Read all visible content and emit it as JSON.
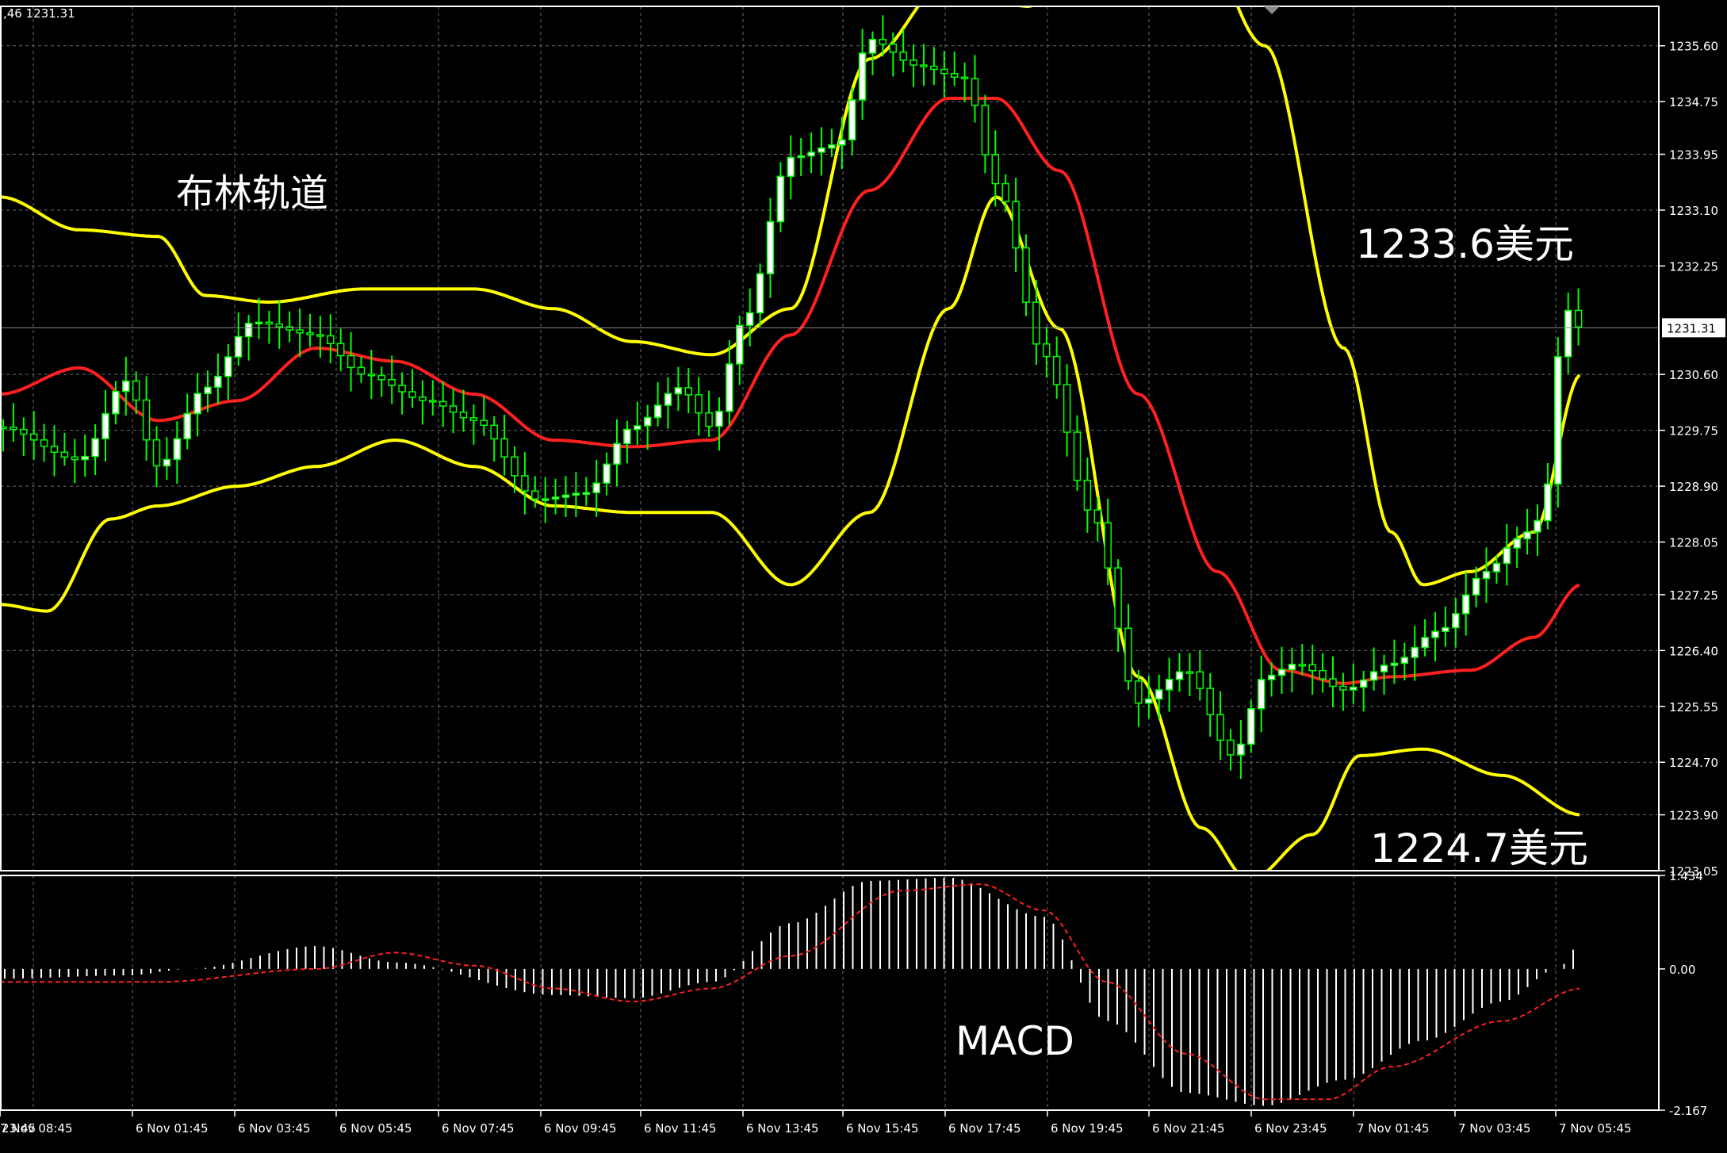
{
  "header": {
    "readout": ",46 1231.31"
  },
  "chart_data": [
    {
      "type": "candlestick",
      "title": "布林轨道",
      "annotation_upper": "1233.6美元",
      "annotation_lower": "1224.7美元",
      "current_price_label": "1231.31",
      "current_price": 1231.31,
      "ylim": [
        1223.05,
        1236.2
      ],
      "y_ticks": [
        1235.6,
        1234.75,
        1233.95,
        1233.1,
        1232.25,
        1230.6,
        1229.75,
        1228.9,
        1228.05,
        1227.25,
        1226.4,
        1225.55,
        1224.7,
        1223.9,
        1223.05
      ],
      "y_tick_labels": [
        "1235.60",
        "1234.75",
        "1233.95",
        "1233.10",
        "1232.25",
        "1230.60",
        "1229.75",
        "1228.90",
        "1228.05",
        "1227.25",
        "1226.40",
        "1225.55",
        "1224.70",
        "1223.90",
        "1223.05"
      ],
      "x_tick_labels": [
        "23:45",
        "6 Nov 01:45",
        "6 Nov 03:45",
        "6 Nov 05:45",
        "6 Nov 07:45",
        "6 Nov 09:45",
        "6 Nov 11:45",
        "6 Nov 13:45",
        "6 Nov 15:45",
        "6 Nov 17:45",
        "6 Nov 19:45",
        "6 Nov 21:45",
        "6 Nov 23:45",
        "7 Nov 01:45",
        "7 Nov 03:45",
        "7 Nov 05:45",
        "7 Nov 08:45"
      ],
      "grid": true,
      "colors": {
        "background": "#000000",
        "candle_up": "#ffffff",
        "candle_down": "#000000",
        "wick": "#00ff00",
        "bands": "#ffff00",
        "middle": "#ff2020",
        "grid": "#6a6a6a"
      },
      "bollinger_upper_anchors": [
        [
          0,
          1233.3
        ],
        [
          0.05,
          1232.8
        ],
        [
          0.1,
          1232.7
        ],
        [
          0.13,
          1231.8
        ],
        [
          0.17,
          1231.7
        ],
        [
          0.23,
          1231.9
        ],
        [
          0.3,
          1231.9
        ],
        [
          0.35,
          1231.6
        ],
        [
          0.4,
          1231.1
        ],
        [
          0.45,
          1230.9
        ],
        [
          0.5,
          1231.6
        ],
        [
          0.55,
          1235.4
        ],
        [
          0.6,
          1236.6
        ],
        [
          0.65,
          1236.2
        ],
        [
          0.7,
          1237.5
        ],
        [
          0.75,
          1237.8
        ],
        [
          0.8,
          1235.6
        ],
        [
          0.85,
          1231.0
        ],
        [
          0.88,
          1228.2
        ],
        [
          0.9,
          1227.4
        ],
        [
          0.93,
          1227.6
        ],
        [
          0.97,
          1228.2
        ],
        [
          1.0,
          1230.6
        ]
      ],
      "bollinger_middle_anchors": [
        [
          0,
          1230.3
        ],
        [
          0.05,
          1230.7
        ],
        [
          0.1,
          1229.9
        ],
        [
          0.15,
          1230.2
        ],
        [
          0.2,
          1231.0
        ],
        [
          0.25,
          1230.8
        ],
        [
          0.3,
          1230.3
        ],
        [
          0.35,
          1229.6
        ],
        [
          0.4,
          1229.5
        ],
        [
          0.45,
          1229.6
        ],
        [
          0.5,
          1231.2
        ],
        [
          0.55,
          1233.4
        ],
        [
          0.6,
          1234.8
        ],
        [
          0.63,
          1234.8
        ],
        [
          0.67,
          1233.7
        ],
        [
          0.72,
          1230.3
        ],
        [
          0.77,
          1227.6
        ],
        [
          0.81,
          1226.1
        ],
        [
          0.85,
          1225.9
        ],
        [
          0.88,
          1226.0
        ],
        [
          0.93,
          1226.1
        ],
        [
          0.97,
          1226.6
        ],
        [
          1.0,
          1227.4
        ]
      ],
      "bollinger_lower_anchors": [
        [
          0,
          1227.1
        ],
        [
          0.03,
          1227.0
        ],
        [
          0.07,
          1228.4
        ],
        [
          0.1,
          1228.6
        ],
        [
          0.15,
          1228.9
        ],
        [
          0.2,
          1229.2
        ],
        [
          0.25,
          1229.6
        ],
        [
          0.3,
          1229.2
        ],
        [
          0.35,
          1228.6
        ],
        [
          0.4,
          1228.5
        ],
        [
          0.45,
          1228.5
        ],
        [
          0.5,
          1227.4
        ],
        [
          0.55,
          1228.5
        ],
        [
          0.6,
          1231.6
        ],
        [
          0.63,
          1233.3
        ],
        [
          0.67,
          1231.3
        ],
        [
          0.72,
          1226.0
        ],
        [
          0.76,
          1223.7
        ],
        [
          0.79,
          1222.9
        ],
        [
          0.83,
          1223.6
        ],
        [
          0.86,
          1224.8
        ],
        [
          0.9,
          1224.9
        ],
        [
          0.95,
          1224.5
        ],
        [
          1.0,
          1223.9
        ]
      ],
      "price_path_anchors": [
        [
          0,
          1229.8
        ],
        [
          0.05,
          1229.3
        ],
        [
          0.08,
          1230.5
        ],
        [
          0.1,
          1229.2
        ],
        [
          0.13,
          1230.4
        ],
        [
          0.16,
          1231.4
        ],
        [
          0.2,
          1231.2
        ],
        [
          0.23,
          1230.6
        ],
        [
          0.27,
          1230.2
        ],
        [
          0.3,
          1229.9
        ],
        [
          0.34,
          1228.7
        ],
        [
          0.37,
          1228.8
        ],
        [
          0.4,
          1229.8
        ],
        [
          0.43,
          1230.4
        ],
        [
          0.45,
          1229.8
        ],
        [
          0.47,
          1231.4
        ],
        [
          0.5,
          1233.9
        ],
        [
          0.53,
          1234.1
        ],
        [
          0.55,
          1235.7
        ],
        [
          0.58,
          1235.3
        ],
        [
          0.61,
          1235.1
        ],
        [
          0.63,
          1233.5
        ],
        [
          0.66,
          1230.9
        ],
        [
          0.69,
          1228.5
        ],
        [
          0.72,
          1225.6
        ],
        [
          0.75,
          1226.1
        ],
        [
          0.78,
          1224.8
        ],
        [
          0.8,
          1226.0
        ],
        [
          0.82,
          1226.2
        ],
        [
          0.85,
          1225.8
        ],
        [
          0.88,
          1226.2
        ],
        [
          0.91,
          1226.7
        ],
        [
          0.94,
          1227.6
        ],
        [
          0.96,
          1228.1
        ],
        [
          0.975,
          1228.4
        ],
        [
          0.99,
          1231.6
        ],
        [
          1.0,
          1231.3
        ]
      ]
    },
    {
      "type": "histogram",
      "title": "MACD",
      "y_tick_labels": [
        "1.434",
        "0.00",
        "-2.167"
      ],
      "ylim": [
        -2.167,
        1.434
      ],
      "colors": {
        "histogram": "#ffffff",
        "signal": "#ff2020"
      },
      "macd_anchors": [
        [
          0,
          -0.15
        ],
        [
          0.08,
          -0.1
        ],
        [
          0.12,
          0.0
        ],
        [
          0.2,
          0.35
        ],
        [
          0.25,
          0.1
        ],
        [
          0.35,
          -0.4
        ],
        [
          0.4,
          -0.45
        ],
        [
          0.45,
          -0.2
        ],
        [
          0.5,
          0.7
        ],
        [
          0.55,
          1.35
        ],
        [
          0.6,
          1.4
        ],
        [
          0.66,
          0.8
        ],
        [
          0.7,
          -0.8
        ],
        [
          0.75,
          -1.9
        ],
        [
          0.8,
          -2.1
        ],
        [
          0.85,
          -1.7
        ],
        [
          0.9,
          -1.1
        ],
        [
          0.95,
          -0.5
        ],
        [
          0.985,
          0.0
        ],
        [
          1.0,
          0.4
        ]
      ],
      "signal_anchors": [
        [
          0,
          -0.2
        ],
        [
          0.1,
          -0.2
        ],
        [
          0.2,
          0.0
        ],
        [
          0.25,
          0.25
        ],
        [
          0.3,
          0.05
        ],
        [
          0.35,
          -0.3
        ],
        [
          0.4,
          -0.5
        ],
        [
          0.45,
          -0.3
        ],
        [
          0.5,
          0.2
        ],
        [
          0.57,
          1.2
        ],
        [
          0.62,
          1.3
        ],
        [
          0.66,
          0.9
        ],
        [
          0.7,
          -0.2
        ],
        [
          0.75,
          -1.3
        ],
        [
          0.8,
          -2.0
        ],
        [
          0.84,
          -2.0
        ],
        [
          0.88,
          -1.5
        ],
        [
          0.95,
          -0.8
        ],
        [
          1.0,
          -0.3
        ]
      ]
    }
  ]
}
